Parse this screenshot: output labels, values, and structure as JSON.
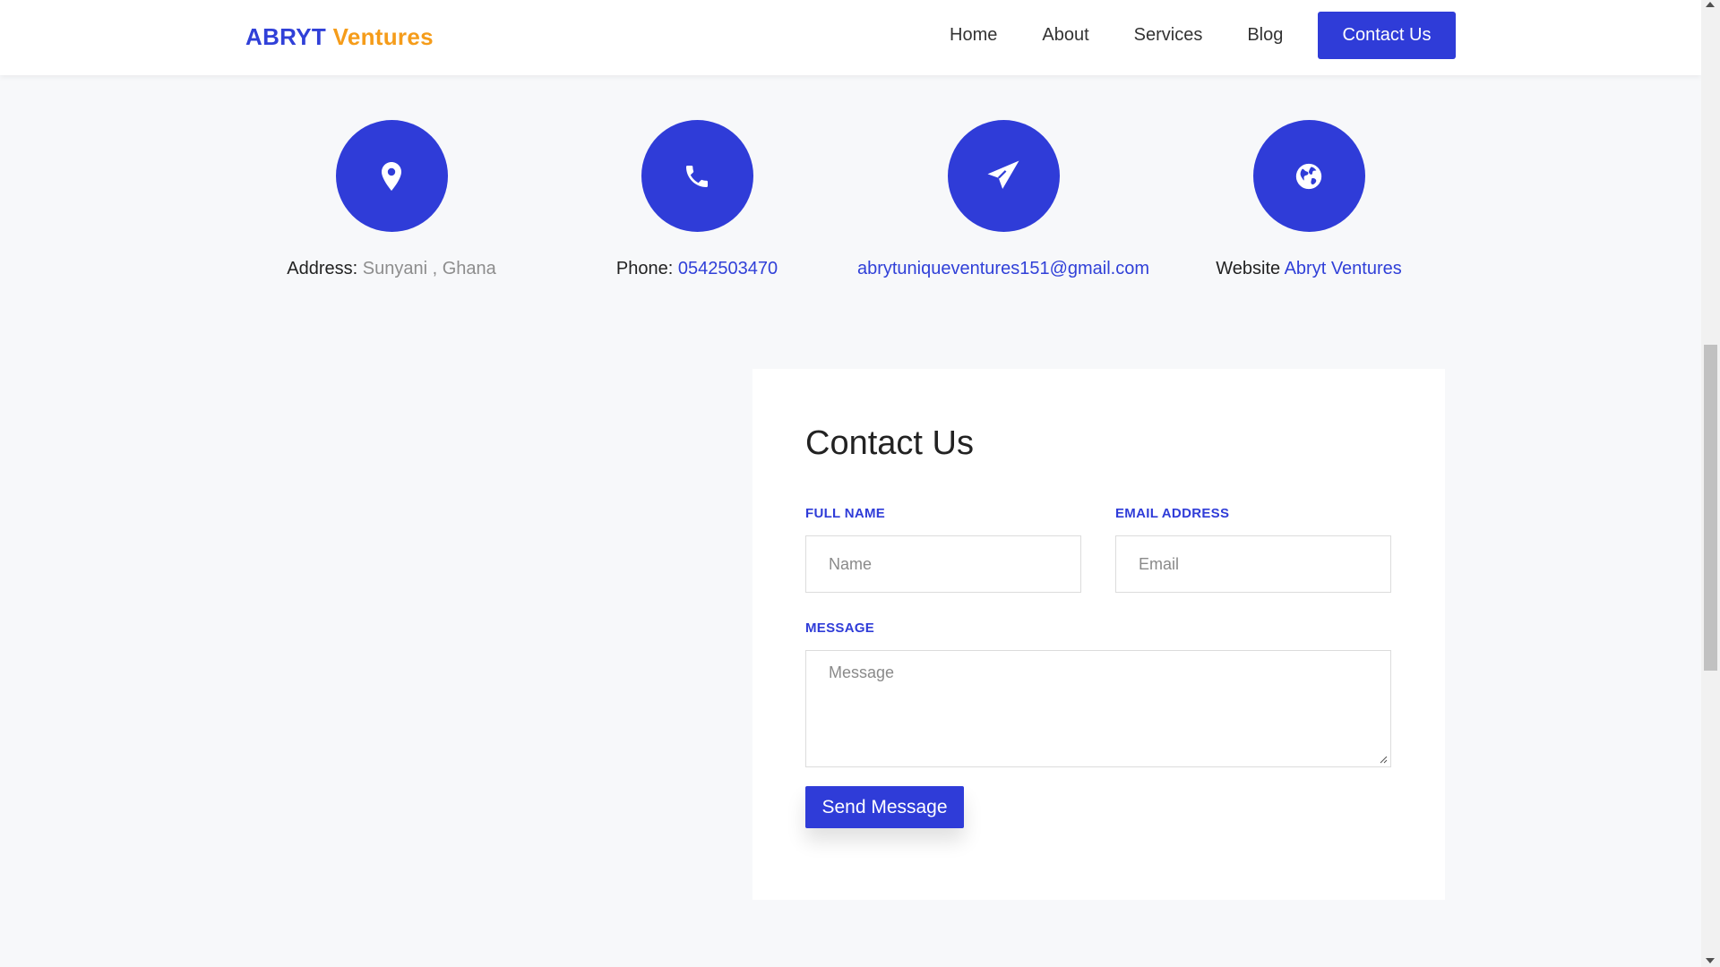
{
  "brand": {
    "part1": "ABRYT",
    "part2": "Ventures"
  },
  "nav": {
    "links": [
      "Home",
      "About",
      "Services",
      "Blog"
    ],
    "cta": "Contact Us"
  },
  "info": {
    "address": {
      "label": "Address:",
      "value": "Sunyani , Ghana",
      "icon": "location-pin-icon"
    },
    "phone": {
      "label": "Phone:",
      "value": "0542503470",
      "icon": "phone-icon"
    },
    "email": {
      "value": "abrytuniqueventures151@gmail.com",
      "icon": "paper-plane-icon"
    },
    "website": {
      "label": "Website",
      "value": "Abryt Ventures",
      "icon": "globe-icon"
    }
  },
  "form": {
    "title": "Contact Us",
    "full_name_label": "FULL NAME",
    "full_name_placeholder": "Name",
    "email_label": "EMAIL ADDRESS",
    "email_placeholder": "Email",
    "message_label": "MESSAGE",
    "message_placeholder": "Message",
    "submit_label": "Send Message"
  },
  "colors": {
    "accent": "#2f3cd8",
    "brand_orange": "#f59c1a",
    "background": "#f7f8fa"
  }
}
